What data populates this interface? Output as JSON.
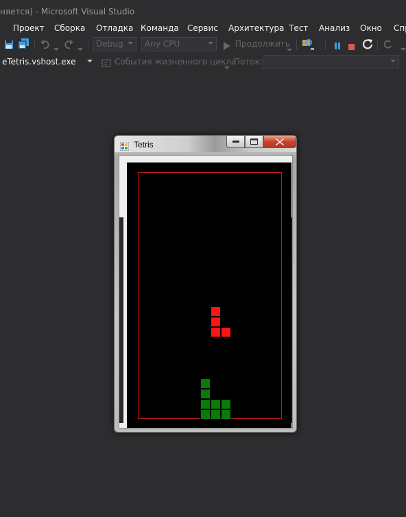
{
  "window": {
    "title": "няется) - Microsoft Visual Studio"
  },
  "menu": {
    "items": [
      "Проект",
      "Сборка",
      "Отладка",
      "Команда",
      "Сервис",
      "Архитектура",
      "Тест",
      "Анализ",
      "Окно",
      "Спр"
    ]
  },
  "toolbar": {
    "config": "Debug",
    "platform": "Any CPU",
    "continue_label": "Продолжить",
    "process": "eTetris.vshost.exe",
    "lifecycle_label": "События жизненного цикла",
    "thread_label": "Поток:",
    "thread_value": ""
  },
  "tetris_window": {
    "title": "Tetris"
  },
  "game": {
    "board_cols": 14,
    "board_rows": 24,
    "active_piece": {
      "color": "#ff1414",
      "cells": [
        [
          7,
          13
        ],
        [
          7,
          14
        ],
        [
          7,
          15
        ],
        [
          8,
          15
        ]
      ]
    },
    "stack": {
      "color": "#0a7a0a",
      "cells": [
        [
          6,
          20
        ],
        [
          6,
          21
        ],
        [
          6,
          22
        ],
        [
          7,
          22
        ],
        [
          8,
          22
        ],
        [
          6,
          23
        ],
        [
          7,
          23
        ],
        [
          8,
          23
        ]
      ]
    }
  },
  "colors": {
    "ide_background": "#2d2d30",
    "board_border": "#c51a1a",
    "pause_icon": "#3e9fe8",
    "stop_icon": "#e05555"
  }
}
